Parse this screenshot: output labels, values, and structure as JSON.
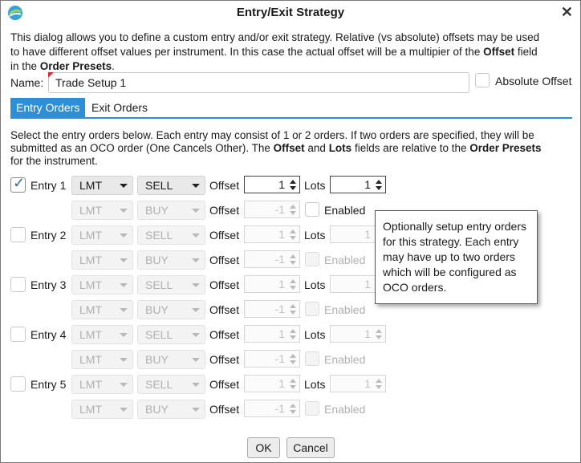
{
  "window": {
    "title": "Entry/Exit Strategy",
    "close_label": "✕"
  },
  "description": {
    "line1": "This dialog allows you to define a custom entry and/or exit strategy.  Relative (vs absolute) offsets may be used",
    "line2": "to have different offset values per instrument.  In this case the actual offset will be a multipier of the ",
    "offset_bold": "Offset",
    "line2_end": " field",
    "line3_start": "in the ",
    "order_presets_bold": "Order Presets",
    "line3_end": "."
  },
  "name": {
    "label": "Name:",
    "value": "Trade Setup 1"
  },
  "absolute_offset": {
    "label": "Absolute Offset",
    "checked": false
  },
  "tabs": [
    {
      "label": "Entry Orders",
      "active": true
    },
    {
      "label": "Exit Orders",
      "active": false
    }
  ],
  "entry_description": {
    "line1": "Select the entry orders below.  Each entry may consist of 1 or 2 orders.  If two orders are specified, they will be",
    "line2_start": "submitted as an OCO order (One Cancels Other). The ",
    "offset_bold": "Offset",
    "and": " and ",
    "lots_bold": "Lots",
    "line2_mid": " fields are relative to the ",
    "order_presets_bold": "Order Presets",
    "line3": "for the instrument."
  },
  "labels": {
    "offset": "Offset",
    "lots": "Lots",
    "enabled": "Enabled"
  },
  "entries": [
    {
      "label": "Entry 1",
      "checked": true,
      "order1": {
        "type": "LMT",
        "side": "SELL",
        "offset": "1",
        "lots": "1"
      },
      "order2": {
        "type": "LMT",
        "side": "BUY",
        "offset": "-1",
        "enabled": false
      }
    },
    {
      "label": "Entry 2",
      "checked": false,
      "order1": {
        "type": "LMT",
        "side": "SELL",
        "offset": "1",
        "lots": "1"
      },
      "order2": {
        "type": "LMT",
        "side": "BUY",
        "offset": "-1",
        "enabled": false
      }
    },
    {
      "label": "Entry 3",
      "checked": false,
      "order1": {
        "type": "LMT",
        "side": "SELL",
        "offset": "1",
        "lots": "1"
      },
      "order2": {
        "type": "LMT",
        "side": "BUY",
        "offset": "-1",
        "enabled": false
      }
    },
    {
      "label": "Entry 4",
      "checked": false,
      "order1": {
        "type": "LMT",
        "side": "SELL",
        "offset": "1",
        "lots": "1"
      },
      "order2": {
        "type": "LMT",
        "side": "BUY",
        "offset": "-1",
        "enabled": false
      }
    },
    {
      "label": "Entry 5",
      "checked": false,
      "order1": {
        "type": "LMT",
        "side": "SELL",
        "offset": "1",
        "lots": "1"
      },
      "order2": {
        "type": "LMT",
        "side": "BUY",
        "offset": "-1",
        "enabled": false
      }
    }
  ],
  "tooltip": {
    "text": "Optionally setup entry orders for this strategy. Each entry may have up to two orders which will be configured as OCO orders."
  },
  "buttons": {
    "ok": "OK",
    "cancel": "Cancel"
  },
  "colors": {
    "accent": "#2d8fd6",
    "required_marker": "#d03030",
    "checkmark": "#2f6fa8"
  },
  "icons": {
    "app": "app-logo-icon",
    "close": "close-icon",
    "dropdown": "chevron-down-icon",
    "spinner": "spinner-arrows-icon",
    "check": "checkmark-icon"
  }
}
